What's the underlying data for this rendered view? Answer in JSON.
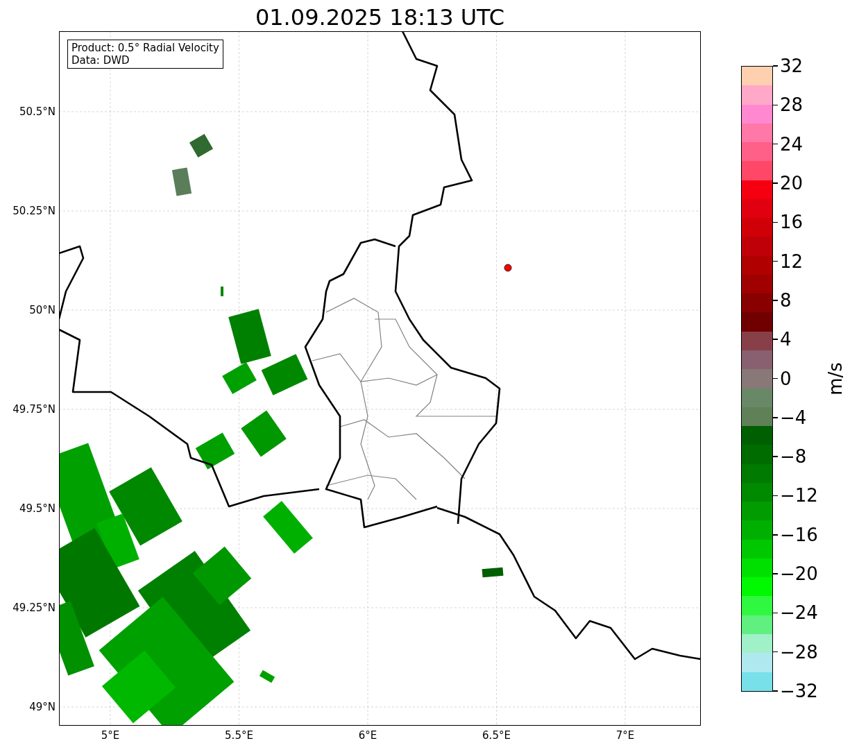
{
  "title": "01.09.2025 18:13 UTC",
  "legend": [
    "Product: 0.5° Radial Velocity",
    "Data: DWD"
  ],
  "map": {
    "lat_ticks": [
      "50.5°N",
      "50.25°N",
      "50°N",
      "49.75°N",
      "49.5°N",
      "49.25°N",
      "49°N"
    ],
    "lon_ticks": [
      "5°E",
      "5.5°E",
      "6°E",
      "6.5°E",
      "7°E"
    ]
  },
  "colorbar": {
    "label": "m/s",
    "ticks": [
      "32",
      "28",
      "24",
      "20",
      "16",
      "12",
      "8",
      "4",
      "0",
      "−4",
      "−8",
      "−12",
      "−16",
      "−20",
      "−24",
      "−28",
      "−32"
    ],
    "segments": [
      {
        "color": "#ffd0b0"
      },
      {
        "color": "#ffa8c8"
      },
      {
        "color": "#ff88d0"
      },
      {
        "color": "#ff78a8"
      },
      {
        "color": "#ff6088"
      },
      {
        "color": "#ff4868"
      },
      {
        "color": "#f50010"
      },
      {
        "color": "#e00010"
      },
      {
        "color": "#d00008"
      },
      {
        "color": "#c00008"
      },
      {
        "color": "#b00000"
      },
      {
        "color": "#a00000"
      },
      {
        "color": "#880000"
      },
      {
        "color": "#700000"
      },
      {
        "color": "#884048"
      },
      {
        "color": "#886070"
      },
      {
        "color": "#887878"
      },
      {
        "color": "#688868"
      },
      {
        "color": "#608058"
      },
      {
        "color": "#005f00"
      },
      {
        "color": "#006c00"
      },
      {
        "color": "#007a00"
      },
      {
        "color": "#008a00"
      },
      {
        "color": "#009c00"
      },
      {
        "color": "#00b000"
      },
      {
        "color": "#00c800"
      },
      {
        "color": "#00e000"
      },
      {
        "color": "#00f800"
      },
      {
        "color": "#30f840"
      },
      {
        "color": "#60f080"
      },
      {
        "color": "#a0f0c8"
      },
      {
        "color": "#b0e8f0"
      },
      {
        "color": "#78e0e8"
      }
    ]
  }
}
